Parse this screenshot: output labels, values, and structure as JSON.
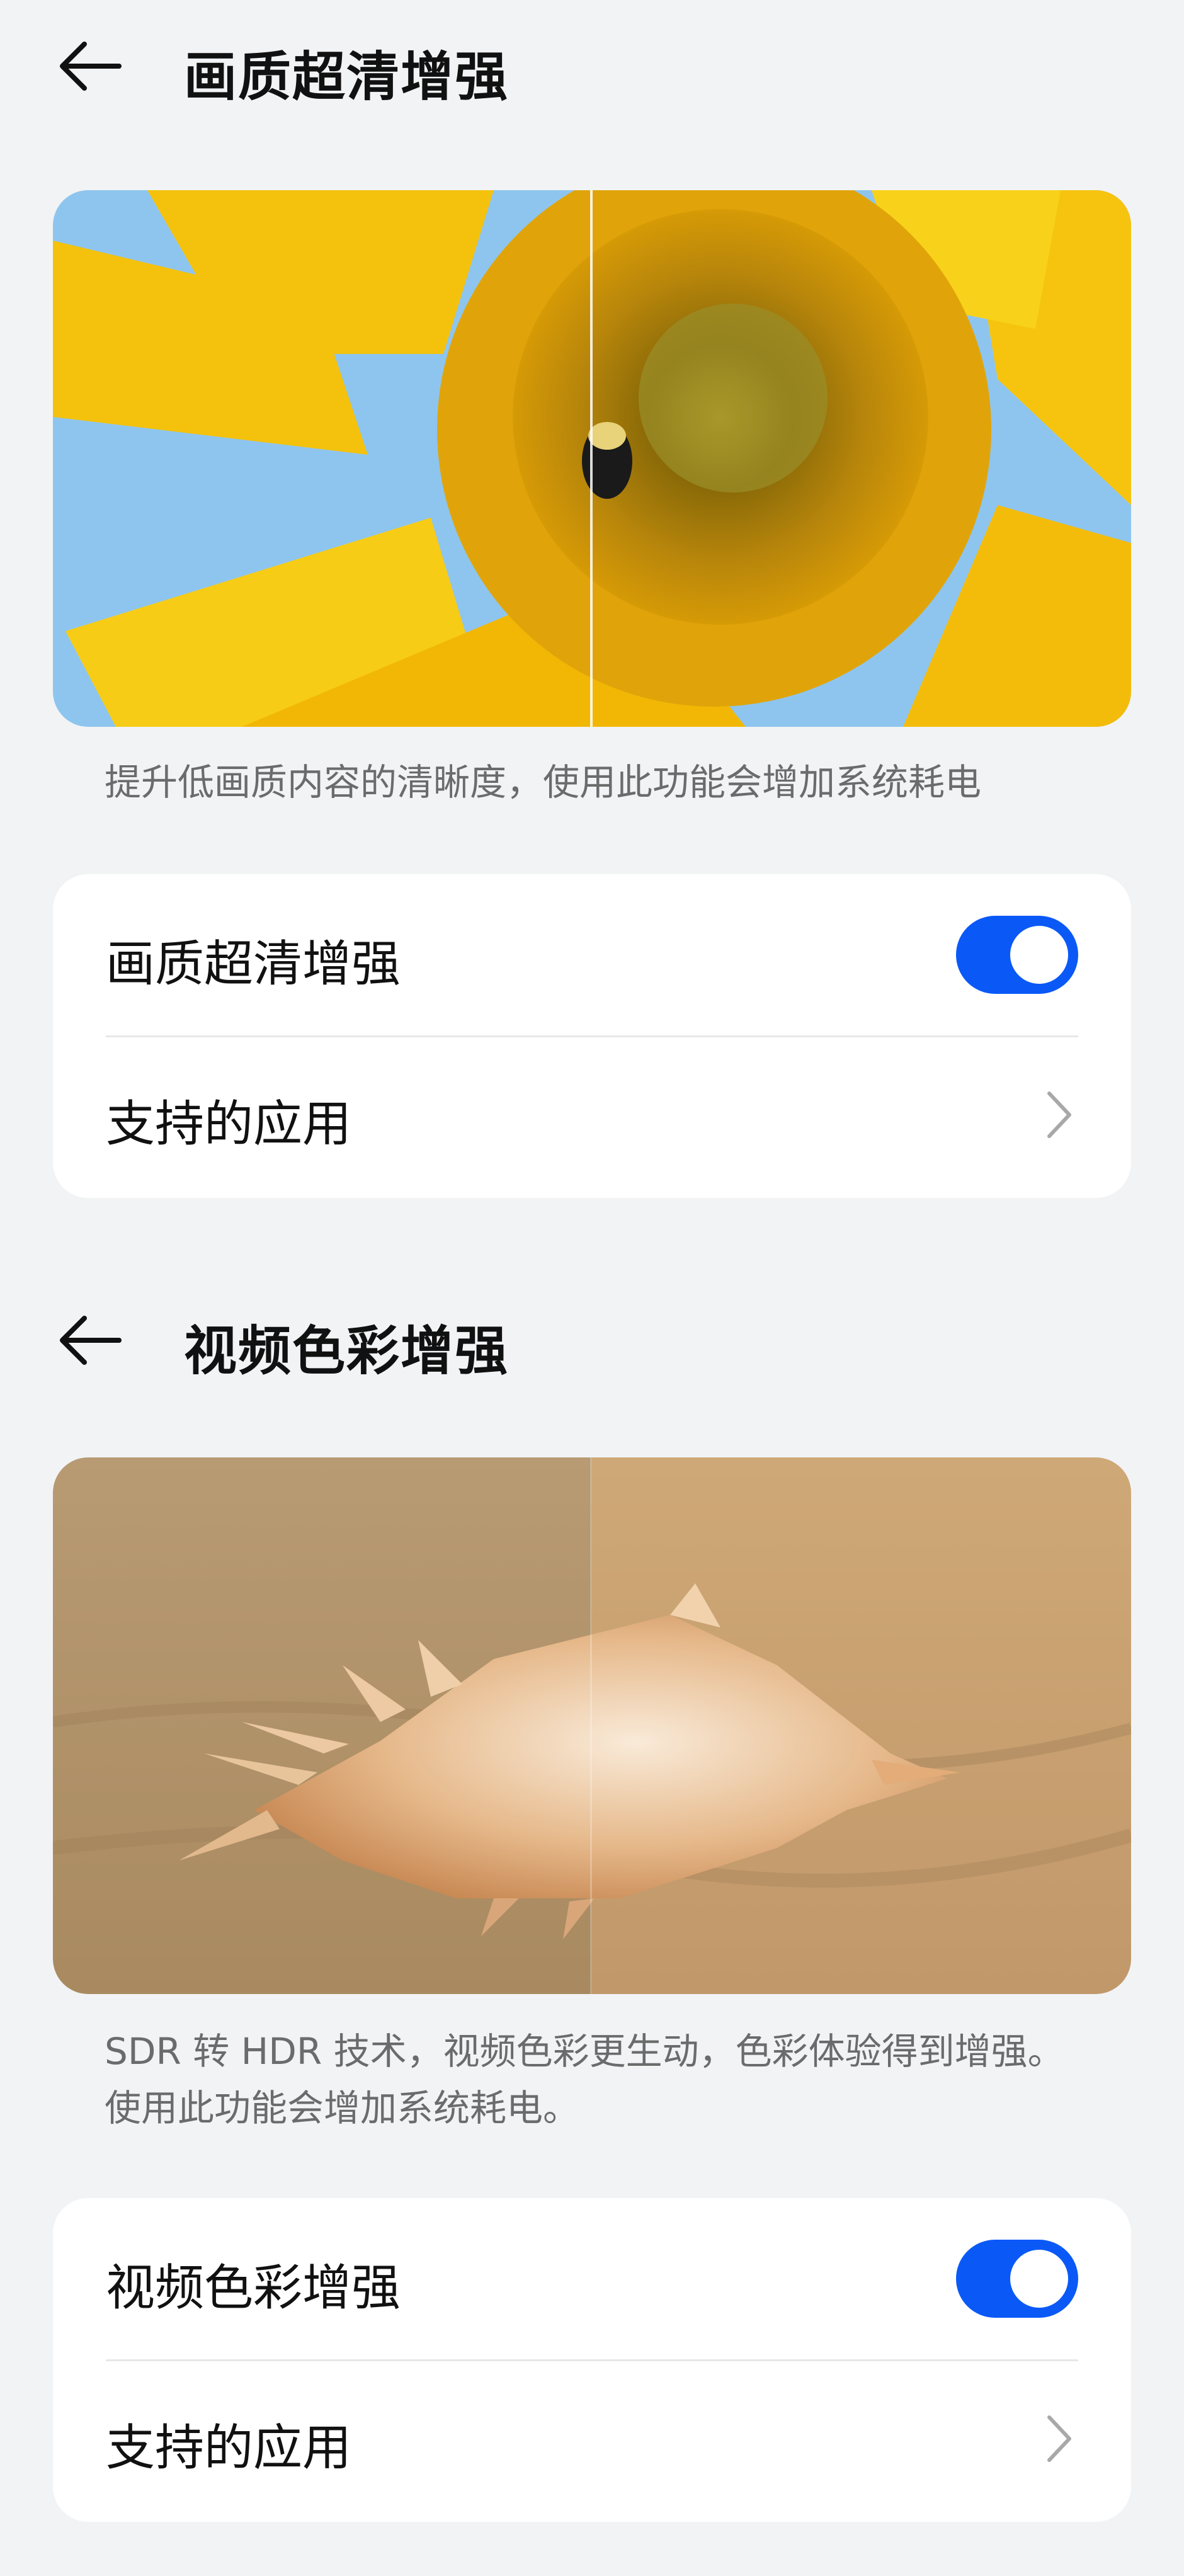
{
  "section1": {
    "title": "画质超清增强",
    "description": "提升低画质内容的清晰度，使用此功能会增加系统耗电",
    "toggle_label": "画质超清增强",
    "toggle_on": true,
    "apps_label": "支持的应用"
  },
  "section2": {
    "title": "视频色彩增强",
    "description": "SDR 转 HDR 技术，视频色彩更生动，色彩体验得到增强。使用此功能会增加系统耗电。",
    "toggle_label": "视频色彩增强",
    "toggle_on": true,
    "apps_label": "支持的应用"
  },
  "icons": {
    "back": "back-arrow-icon",
    "chevron": "chevron-right-icon"
  },
  "colors": {
    "background": "#f1f3f5",
    "card": "#ffffff",
    "accent": "#0a59f7",
    "secondary_text": "#6b6b6b"
  }
}
